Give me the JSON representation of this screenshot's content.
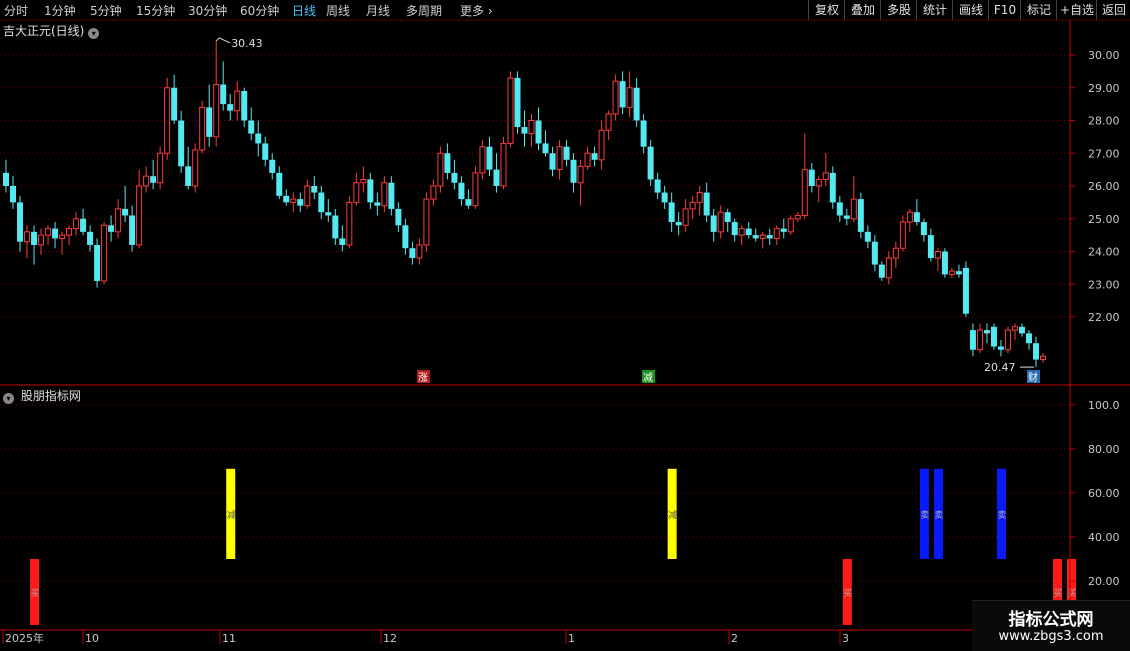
{
  "toolbar": {
    "periods": [
      {
        "label": "分时",
        "active": false
      },
      {
        "label": "1分钟",
        "active": false
      },
      {
        "label": "5分钟",
        "active": false
      },
      {
        "label": "15分钟",
        "active": false
      },
      {
        "label": "30分钟",
        "active": false
      },
      {
        "label": "60分钟",
        "active": false
      },
      {
        "label": "日线",
        "active": true
      },
      {
        "label": "周线",
        "active": false
      },
      {
        "label": "月线",
        "active": false
      },
      {
        "label": "多周期",
        "active": false
      },
      {
        "label": "更多",
        "active": false
      }
    ],
    "more_arrow": "›",
    "right_tools": [
      "复权",
      "叠加",
      "多股",
      "统计",
      "画线",
      "F10",
      "标记",
      "+自选",
      "返回"
    ]
  },
  "main_panel": {
    "title": "吉大正元(日线)",
    "price_axis": [
      "30.00",
      "29.00",
      "28.00",
      "27.00",
      "26.00",
      "25.00",
      "24.00",
      "23.00",
      "22.00"
    ],
    "high_label": "30.43",
    "low_label": "20.47",
    "event_markers": [
      {
        "text": "涨",
        "color": "#cc2222"
      },
      {
        "text": "减",
        "color": "#22aa22"
      },
      {
        "text": "财",
        "color": "#2f7fd0"
      }
    ]
  },
  "indicator_panel": {
    "title": "股朋指标网",
    "value_axis": [
      "100.0",
      "80.00",
      "60.00",
      "40.00",
      "20.00"
    ],
    "bar_labels": {
      "red": "买",
      "yellow": "减",
      "blue": "卖"
    }
  },
  "time_axis": [
    "2025年",
    "10",
    "11",
    "12",
    "1",
    "2",
    "3"
  ],
  "watermark": {
    "line1": "指标公式网",
    "line2": "www.zbgs3.com"
  },
  "colors": {
    "up": "#ff3b3b",
    "down": "#54e8f0",
    "grid": "#7a0000",
    "axis": "#c00000",
    "text": "#c8c8c8"
  },
  "chart_data": {
    "type": "candlestick",
    "ohlc": [
      [
        26.4,
        26.8,
        25.8,
        26.0
      ],
      [
        26.0,
        26.3,
        25.3,
        25.5
      ],
      [
        25.5,
        25.7,
        24.0,
        24.3
      ],
      [
        24.3,
        24.8,
        23.8,
        24.6
      ],
      [
        24.6,
        24.8,
        23.6,
        24.2
      ],
      [
        24.2,
        24.7,
        23.9,
        24.5
      ],
      [
        24.5,
        24.8,
        24.2,
        24.7
      ],
      [
        24.7,
        24.9,
        24.1,
        24.4
      ],
      [
        24.4,
        24.6,
        23.9,
        24.5
      ],
      [
        24.5,
        24.8,
        24.2,
        24.7
      ],
      [
        24.7,
        25.2,
        24.5,
        25.0
      ],
      [
        25.0,
        25.3,
        24.5,
        24.6
      ],
      [
        24.6,
        24.8,
        24.0,
        24.2
      ],
      [
        24.2,
        24.4,
        22.9,
        23.1
      ],
      [
        23.1,
        24.9,
        23.0,
        24.8
      ],
      [
        24.8,
        25.1,
        24.3,
        24.6
      ],
      [
        24.6,
        25.6,
        24.4,
        25.3
      ],
      [
        25.3,
        26.0,
        24.9,
        25.1
      ],
      [
        25.1,
        25.4,
        24.0,
        24.2
      ],
      [
        24.2,
        26.5,
        24.1,
        26.0
      ],
      [
        26.0,
        26.6,
        25.8,
        26.3
      ],
      [
        26.3,
        26.8,
        25.9,
        26.1
      ],
      [
        26.1,
        27.2,
        25.9,
        27.0
      ],
      [
        27.0,
        29.3,
        26.8,
        29.0
      ],
      [
        29.0,
        29.4,
        27.9,
        28.0
      ],
      [
        28.0,
        28.3,
        26.4,
        26.6
      ],
      [
        26.6,
        27.2,
        25.9,
        26.0
      ],
      [
        26.0,
        27.3,
        25.8,
        27.1
      ],
      [
        27.1,
        28.6,
        27.0,
        28.4
      ],
      [
        28.4,
        29.1,
        27.2,
        27.5
      ],
      [
        27.5,
        30.43,
        27.2,
        29.1
      ],
      [
        29.1,
        29.8,
        28.3,
        28.5
      ],
      [
        28.5,
        28.8,
        28.0,
        28.3
      ],
      [
        28.3,
        29.2,
        28.0,
        28.9
      ],
      [
        28.9,
        29.0,
        27.8,
        28.0
      ],
      [
        28.0,
        28.4,
        27.4,
        27.6
      ],
      [
        27.6,
        28.0,
        26.9,
        27.3
      ],
      [
        27.3,
        27.5,
        26.6,
        26.8
      ],
      [
        26.8,
        27.0,
        26.2,
        26.4
      ],
      [
        26.4,
        26.6,
        25.6,
        25.7
      ],
      [
        25.7,
        25.9,
        25.4,
        25.5
      ],
      [
        25.5,
        25.8,
        25.2,
        25.6
      ],
      [
        25.6,
        25.8,
        25.2,
        25.4
      ],
      [
        25.4,
        26.2,
        25.3,
        26.0
      ],
      [
        26.0,
        26.3,
        25.6,
        25.8
      ],
      [
        25.8,
        26.0,
        25.0,
        25.2
      ],
      [
        25.2,
        25.6,
        24.9,
        25.1
      ],
      [
        25.1,
        25.3,
        24.2,
        24.4
      ],
      [
        24.4,
        24.8,
        24.0,
        24.2
      ],
      [
        24.2,
        25.7,
        24.1,
        25.5
      ],
      [
        25.5,
        26.4,
        25.4,
        26.1
      ],
      [
        26.1,
        26.6,
        25.8,
        26.2
      ],
      [
        26.2,
        26.4,
        25.3,
        25.5
      ],
      [
        25.5,
        25.8,
        25.1,
        25.4
      ],
      [
        25.4,
        26.3,
        25.2,
        26.1
      ],
      [
        26.1,
        26.3,
        25.1,
        25.3
      ],
      [
        25.3,
        25.5,
        24.6,
        24.8
      ],
      [
        24.8,
        25.0,
        23.9,
        24.1
      ],
      [
        24.1,
        24.3,
        23.6,
        23.8
      ],
      [
        23.8,
        24.4,
        23.6,
        24.2
      ],
      [
        24.2,
        25.8,
        24.0,
        25.6
      ],
      [
        25.6,
        26.2,
        25.4,
        26.0
      ],
      [
        26.0,
        27.2,
        25.8,
        27.0
      ],
      [
        27.0,
        27.3,
        26.2,
        26.4
      ],
      [
        26.4,
        26.8,
        25.9,
        26.1
      ],
      [
        26.1,
        26.3,
        25.4,
        25.6
      ],
      [
        25.6,
        25.9,
        25.3,
        25.4
      ],
      [
        25.4,
        26.6,
        25.3,
        26.4
      ],
      [
        26.4,
        27.4,
        26.2,
        27.2
      ],
      [
        27.2,
        27.5,
        26.3,
        26.5
      ],
      [
        26.5,
        27.0,
        25.8,
        26.0
      ],
      [
        26.0,
        27.5,
        25.9,
        27.3
      ],
      [
        27.3,
        29.5,
        27.2,
        29.3
      ],
      [
        29.3,
        29.5,
        27.6,
        27.8
      ],
      [
        27.8,
        28.3,
        27.2,
        27.6
      ],
      [
        27.6,
        28.2,
        27.2,
        28.0
      ],
      [
        28.0,
        28.4,
        27.1,
        27.3
      ],
      [
        27.3,
        27.7,
        26.9,
        27.0
      ],
      [
        27.0,
        27.2,
        26.3,
        26.5
      ],
      [
        26.5,
        27.4,
        26.2,
        27.2
      ],
      [
        27.2,
        27.4,
        26.6,
        26.8
      ],
      [
        26.8,
        27.0,
        25.8,
        26.1
      ],
      [
        26.1,
        26.8,
        25.4,
        26.6
      ],
      [
        26.6,
        27.2,
        26.5,
        27.0
      ],
      [
        27.0,
        27.2,
        26.6,
        26.8
      ],
      [
        26.8,
        28.0,
        26.5,
        27.7
      ],
      [
        27.7,
        28.3,
        27.4,
        28.2
      ],
      [
        28.2,
        29.4,
        28.0,
        29.2
      ],
      [
        29.2,
        29.5,
        28.2,
        28.4
      ],
      [
        28.4,
        29.5,
        28.1,
        29.0
      ],
      [
        29.0,
        29.3,
        27.8,
        28.0
      ],
      [
        28.0,
        28.2,
        27.0,
        27.2
      ],
      [
        27.2,
        27.4,
        26.0,
        26.2
      ],
      [
        26.2,
        26.4,
        25.6,
        25.8
      ],
      [
        25.8,
        26.0,
        25.3,
        25.5
      ],
      [
        25.5,
        25.8,
        24.6,
        24.9
      ],
      [
        24.9,
        25.2,
        24.5,
        24.8
      ],
      [
        24.8,
        25.6,
        24.6,
        25.3
      ],
      [
        25.3,
        25.7,
        25.0,
        25.5
      ],
      [
        25.5,
        26.0,
        25.1,
        25.8
      ],
      [
        25.8,
        26.1,
        24.9,
        25.1
      ],
      [
        25.1,
        25.3,
        24.3,
        24.6
      ],
      [
        24.6,
        25.4,
        24.4,
        25.2
      ],
      [
        25.2,
        25.3,
        24.6,
        24.9
      ],
      [
        24.9,
        25.0,
        24.3,
        24.5
      ],
      [
        24.5,
        24.8,
        24.2,
        24.7
      ],
      [
        24.7,
        24.9,
        24.4,
        24.5
      ],
      [
        24.5,
        24.7,
        24.3,
        24.4
      ],
      [
        24.4,
        24.6,
        24.1,
        24.5
      ],
      [
        24.5,
        24.7,
        24.2,
        24.4
      ],
      [
        24.4,
        24.8,
        24.2,
        24.7
      ],
      [
        24.7,
        25.0,
        24.4,
        24.6
      ],
      [
        24.6,
        25.1,
        24.5,
        25.0
      ],
      [
        25.0,
        25.2,
        24.9,
        25.1
      ],
      [
        25.1,
        27.6,
        25.0,
        26.5
      ],
      [
        26.5,
        26.7,
        25.8,
        26.0
      ],
      [
        26.0,
        26.3,
        25.5,
        26.2
      ],
      [
        26.2,
        27.0,
        26.0,
        26.4
      ],
      [
        26.4,
        26.6,
        25.3,
        25.5
      ],
      [
        25.5,
        25.7,
        24.9,
        25.1
      ],
      [
        25.1,
        25.3,
        24.8,
        25.0
      ],
      [
        25.0,
        26.3,
        24.9,
        25.6
      ],
      [
        25.6,
        25.8,
        24.4,
        24.6
      ],
      [
        24.6,
        24.8,
        24.1,
        24.3
      ],
      [
        24.3,
        24.5,
        23.4,
        23.6
      ],
      [
        23.6,
        23.7,
        23.1,
        23.2
      ],
      [
        23.2,
        24.0,
        23.0,
        23.8
      ],
      [
        23.8,
        24.3,
        23.5,
        24.1
      ],
      [
        24.1,
        25.1,
        24.0,
        24.9
      ],
      [
        24.9,
        25.3,
        24.6,
        25.2
      ],
      [
        25.2,
        25.6,
        24.8,
        24.9
      ],
      [
        24.9,
        25.0,
        24.3,
        24.5
      ],
      [
        24.5,
        24.7,
        23.7,
        23.8
      ],
      [
        23.8,
        24.1,
        23.4,
        24.0
      ],
      [
        24.0,
        24.1,
        23.2,
        23.3
      ],
      [
        23.3,
        23.5,
        23.2,
        23.4
      ],
      [
        23.4,
        23.6,
        23.2,
        23.3
      ],
      [
        23.5,
        23.7,
        22.0,
        22.1
      ],
      [
        21.6,
        21.8,
        20.8,
        21.0
      ],
      [
        21.0,
        21.8,
        20.9,
        21.6
      ],
      [
        21.6,
        21.8,
        21.2,
        21.5
      ],
      [
        21.7,
        21.8,
        21.0,
        21.1
      ],
      [
        21.1,
        21.3,
        20.8,
        21.0
      ],
      [
        21.0,
        21.7,
        20.9,
        21.6
      ],
      [
        21.6,
        21.8,
        21.3,
        21.7
      ],
      [
        21.7,
        21.8,
        21.4,
        21.5
      ],
      [
        21.5,
        21.6,
        21.0,
        21.2
      ],
      [
        21.2,
        21.4,
        20.47,
        20.7
      ],
      [
        20.7,
        20.9,
        20.6,
        20.8
      ]
    ],
    "indicator_bars": [
      {
        "index": 4,
        "color": "red",
        "from": 0,
        "to": 30
      },
      {
        "index": 32,
        "color": "yellow",
        "from": 30,
        "to": 71
      },
      {
        "index": 95,
        "color": "yellow",
        "from": 30,
        "to": 71
      },
      {
        "index": 120,
        "color": "red",
        "from": 0,
        "to": 30
      },
      {
        "index": 131,
        "color": "blue",
        "from": 30,
        "to": 71
      },
      {
        "index": 133,
        "color": "blue",
        "from": 30,
        "to": 71
      },
      {
        "index": 142,
        "color": "blue",
        "from": 30,
        "to": 71
      },
      {
        "index": 150,
        "color": "red",
        "from": 0,
        "to": 30
      },
      {
        "index": 152,
        "color": "red",
        "from": 0,
        "to": 30
      }
    ],
    "price_range": [
      20.0,
      30.8
    ],
    "indicator_range": [
      0,
      105
    ]
  }
}
